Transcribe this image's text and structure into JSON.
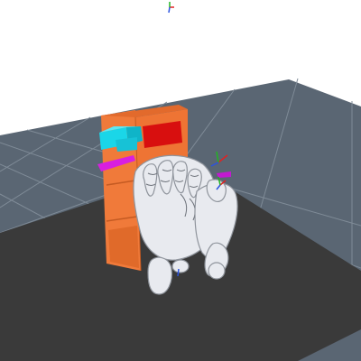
{
  "viewport": {
    "background": "#ffffff",
    "floor_color": "#5a6673",
    "floor_grid_color": "#7f8b97",
    "work_surface_color": "#3a3a3a"
  },
  "shelf": {
    "body_color": "#f07a3a",
    "edge_color": "#c45a22",
    "red_panel_color": "#d80f0f"
  },
  "objects": {
    "cyan_block_color": "#1ad6e8",
    "magenta_tool_color": "#d81fe0",
    "robot_hand_color": "#e8eaef"
  },
  "axes": {
    "x_color": "#e22222",
    "y_color": "#22b522",
    "z_color": "#2a52e0"
  }
}
